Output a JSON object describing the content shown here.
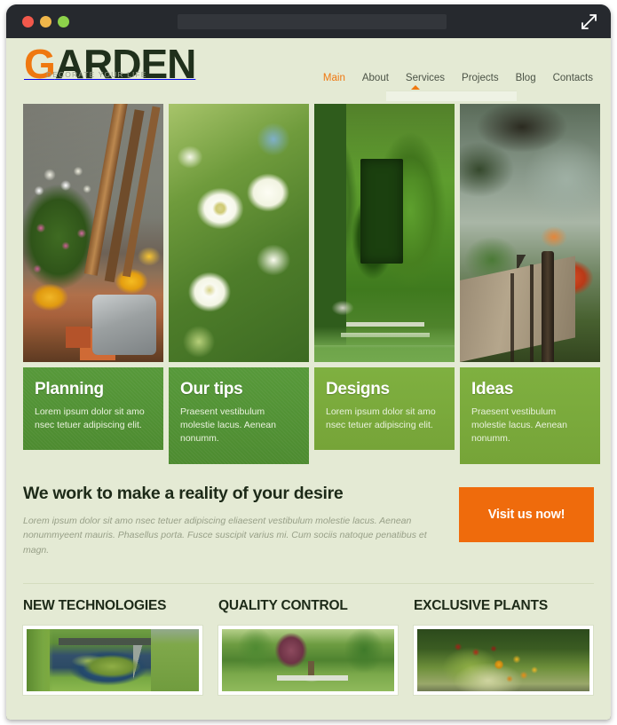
{
  "browser": {
    "traffic_lights": [
      "close",
      "minimize",
      "maximize"
    ],
    "address_value": "",
    "address_placeholder": "",
    "expand_icon": "expand-diagonal-icon"
  },
  "site": {
    "logo": {
      "first_letter": "G",
      "rest": "ARDEN",
      "tagline": "DECORATE YOUR LIFE",
      "accent_color": "#ef7810",
      "text_color": "#20301c"
    },
    "nav": {
      "items": [
        {
          "label": "Main",
          "active": true
        },
        {
          "label": "About",
          "active": false
        },
        {
          "label": "Services",
          "active": false
        },
        {
          "label": "Projects",
          "active": false
        },
        {
          "label": "Blog",
          "active": false
        },
        {
          "label": "Contacts",
          "active": false
        }
      ]
    },
    "hero": {
      "slides": [
        {
          "alt": "garden-tools-and-flower-pots",
          "style": "img-tools"
        },
        {
          "alt": "white-apple-blossoms",
          "style": "img-blossom"
        },
        {
          "alt": "topiary-hedge-garden-with-steps",
          "style": "img-topiary"
        },
        {
          "alt": "misty-garden-wooden-bridge",
          "style": "img-bridge"
        }
      ]
    },
    "cards": [
      {
        "title": "Planning",
        "text": "Lorem ipsum dolor sit amo nsec tetuer adipiscing elit.",
        "tone": "dark"
      },
      {
        "title": "Our tips",
        "text": "Praesent vestibulum molestie lacus. Aenean nonumm.",
        "tone": "dark"
      },
      {
        "title": "Designs",
        "text": "Lorem ipsum dolor sit amo nsec tetuer adipiscing elit.",
        "tone": "light"
      },
      {
        "title": "Ideas",
        "text": "Praesent vestibulum molestie lacus. Aenean nonumm.",
        "tone": "light"
      }
    ],
    "promo": {
      "title": "We work to make a reality of your desire",
      "text": "Lorem ipsum dolor sit amo nsec tetuer adipiscing eliaesent vestibulum molestie lacus. Aenean nonummyeent mauris. Phasellus porta. Fusce suscipit varius mi. Cum sociis natoque penatibus et magn.",
      "cta_label": "Visit us now!",
      "cta_color": "#ef6b0c"
    },
    "bottom_sections": [
      {
        "title": "NEW TECHNOLOGIES",
        "image_alt": "garden-pond-with-water-lilies",
        "style": "thumb-pond"
      },
      {
        "title": "QUALITY CONTROL",
        "image_alt": "formal-garden-with-fountain",
        "style": "thumb-fountain"
      },
      {
        "title": "EXCLUSIVE PLANTS",
        "image_alt": "colorful-flower-bed-pansies",
        "style": "thumb-flowers"
      }
    ],
    "colors": {
      "page_background": "#e4ead4",
      "card_dark_green": "#519032",
      "card_light_green": "#7aab3d",
      "heading": "#1d2a18",
      "muted_text": "#98a088"
    }
  }
}
